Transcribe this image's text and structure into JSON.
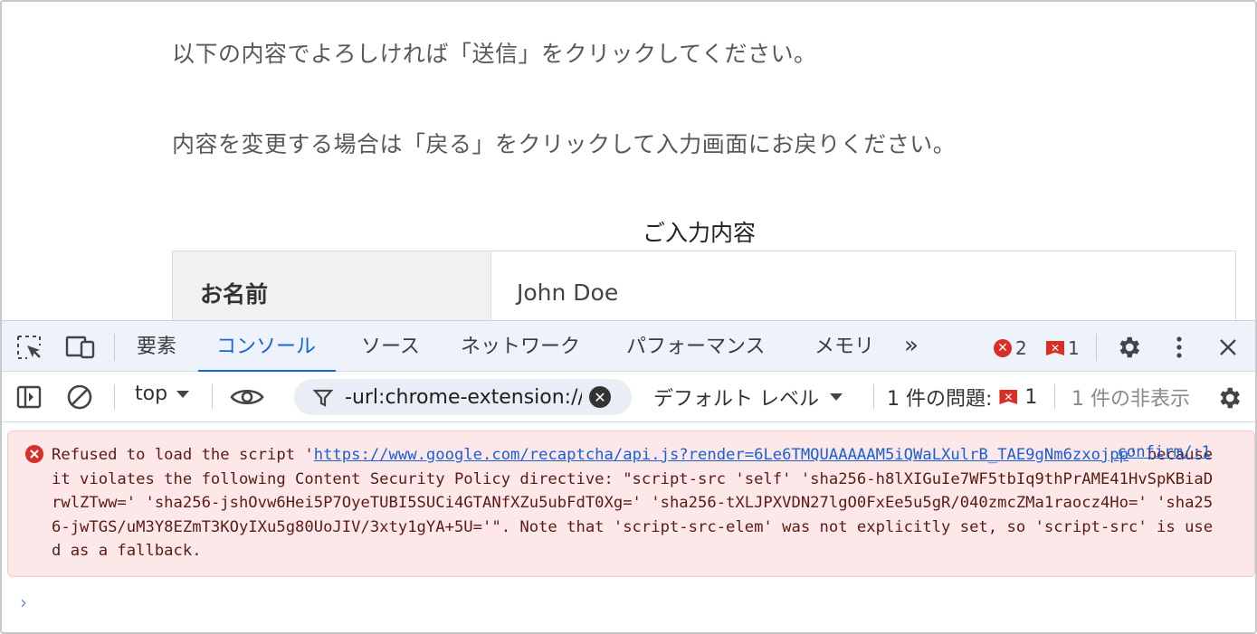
{
  "page": {
    "line1": "以下の内容でよろしければ「送信」をクリックしてください。",
    "line2": "内容を変更する場合は「戻る」をクリックして入力画面にお戻りください。",
    "caption": "ご入力内容",
    "rows": [
      {
        "label": "お名前",
        "value": "John Doe"
      }
    ]
  },
  "devtools": {
    "tabs": [
      "要素",
      "コンソール",
      "ソース",
      "ネットワーク",
      "パフォーマンス",
      "メモリ"
    ],
    "active_tab": "コンソール",
    "more_tabs": "»",
    "error_count": "2",
    "issue_count": "1",
    "filterbar": {
      "context": "top",
      "filter_value": "-url:chrome-extension://",
      "levels": "デフォルト レベル",
      "issues_label": "1 件の問題:",
      "issues_count": "1",
      "hidden_label": "1 件の非表示"
    },
    "console": {
      "source": "confirm/:1",
      "msg_prefix": "Refused to load the script '",
      "msg_url": "https://www.google.com/recaptcha/api.js?render=6Le6TMQUAAAAAM5iQWaLXulrB_TAE9gNm6zxojpp",
      "msg_body": "' because it violates the following Content Security Policy directive: \"script-src 'self' 'sha256-h8lXIGuIe7WF5tbIq9thPrAME41HvSpKBiaDrwlZTww=' 'sha256-jshOvw6Hei5P7OyeTUBI5SUCi4GTANfXZu5ubFdT0Xg=' 'sha256-tXLJPXVDN27lgO0FxEe5u5gR/040zmcZMa1raocz4Ho=' 'sha256-jwTGS/uM3Y8EZmT3KOyIXu5g80UoJIV/3xty1gYA+5U='\". Note that 'script-src-elem' was not explicitly set, so 'script-src' is used as a fallback.",
      "prompt": "›"
    }
  }
}
